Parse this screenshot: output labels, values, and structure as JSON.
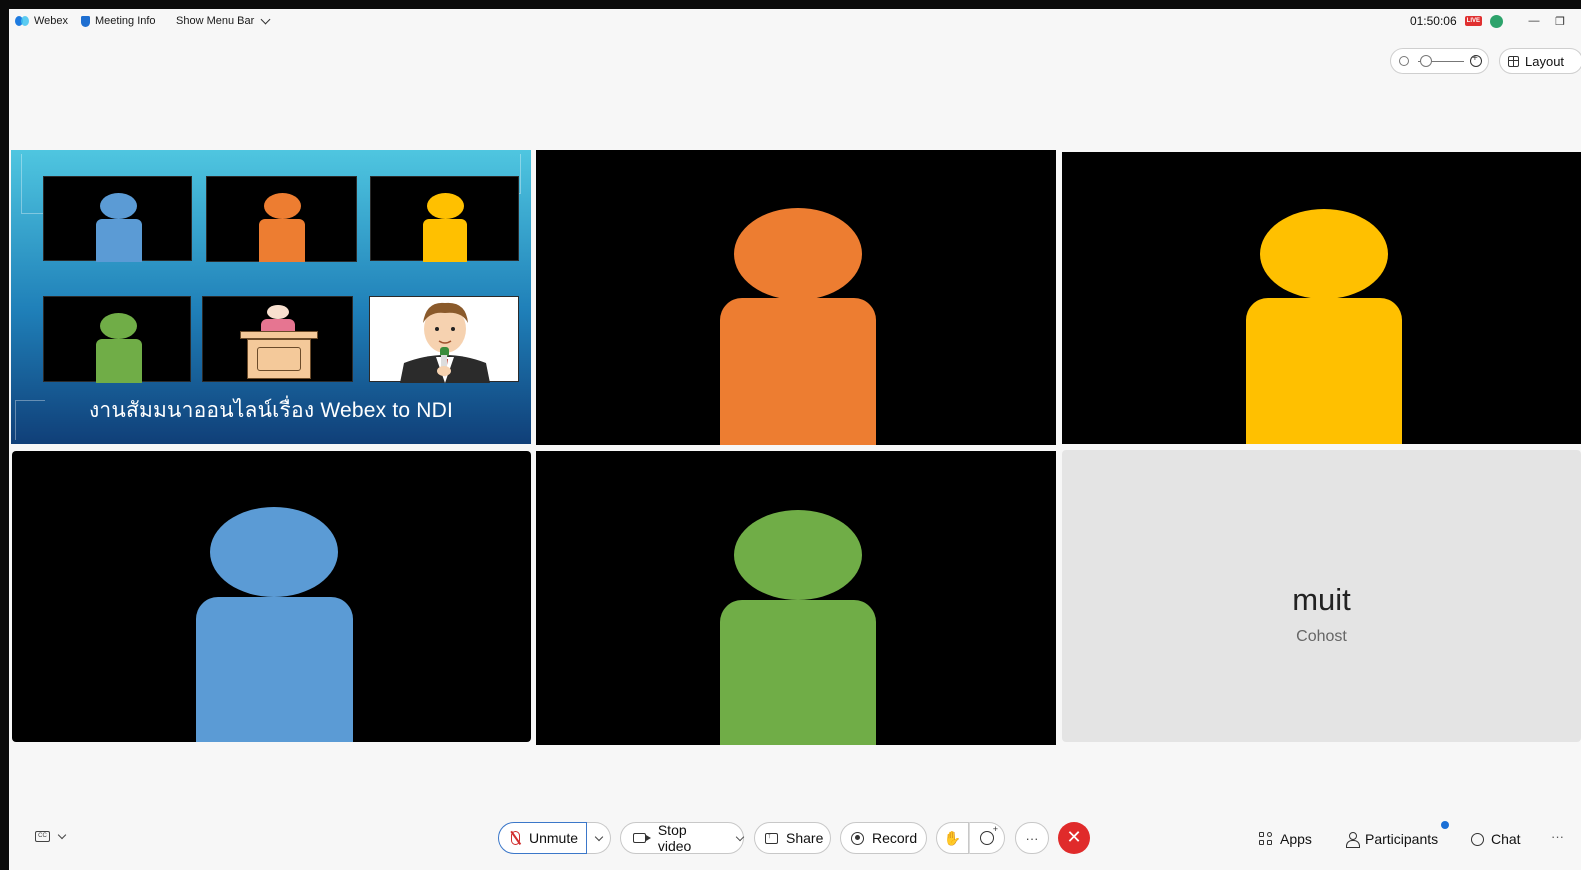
{
  "topbar": {
    "app_name": "Webex",
    "meeting_info": "Meeting Info",
    "show_menu_bar": "Show Menu Bar",
    "timer": "01:50:06",
    "live_badge": "LIVE",
    "minimize": "—",
    "restore": "❐"
  },
  "view": {
    "layout_label": "Layout",
    "zoom_level": 0.1
  },
  "tiles": {
    "shared_screen_caption": "งานสัมมนาออนไลน์เรื่อง Webex to NDI",
    "participant_name": "muit",
    "participant_role": "Cohost"
  },
  "toolbar": {
    "unmute": "Unmute",
    "stop_video": "Stop video",
    "share": "Share",
    "record": "Record",
    "more": "···",
    "leave": "✕",
    "apps": "Apps",
    "participants": "Participants",
    "chat": "Chat",
    "overflow": "···"
  },
  "colors": {
    "orange": "#ed7d31",
    "yellow": "#ffc000",
    "blue": "#5b9bd5",
    "green": "#70ad47",
    "leave_red": "#e02b2b",
    "accent_blue": "#1a6fd6"
  },
  "icons": [
    "webex-logo-icon",
    "shield-icon",
    "chevron-down-icon",
    "live-icon",
    "network-icon",
    "zoom-out-icon",
    "zoom-in-icon",
    "grid-icon",
    "closed-captions-icon",
    "microphone-muted-icon",
    "camera-icon",
    "share-screen-icon",
    "record-icon",
    "raise-hand-icon",
    "reactions-icon",
    "more-icon",
    "leave-icon",
    "apps-icon",
    "participants-icon",
    "chat-icon"
  ]
}
